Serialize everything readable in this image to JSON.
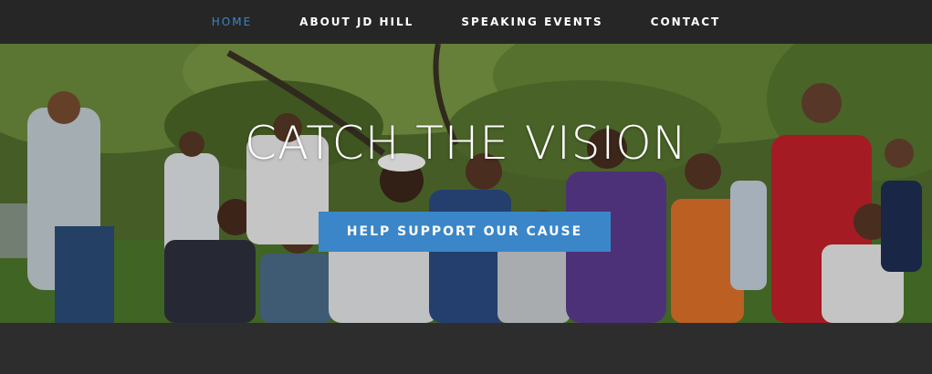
{
  "nav": {
    "items": [
      {
        "label": "HOME",
        "active": true
      },
      {
        "label": "ABOUT JD HILL",
        "active": false
      },
      {
        "label": "SPEAKING EVENTS",
        "active": false
      },
      {
        "label": "CONTACT",
        "active": false
      }
    ]
  },
  "hero": {
    "title": "CATCH THE VISION",
    "cta_label": "HELP SUPPORT OUR CAUSE",
    "image_subject": "group-photo-of-kids-under-trees"
  },
  "colors": {
    "accent": "#3a86c8",
    "nav_bg": "#262626",
    "page_bg": "#2b2b2b",
    "text": "#ffffff"
  }
}
